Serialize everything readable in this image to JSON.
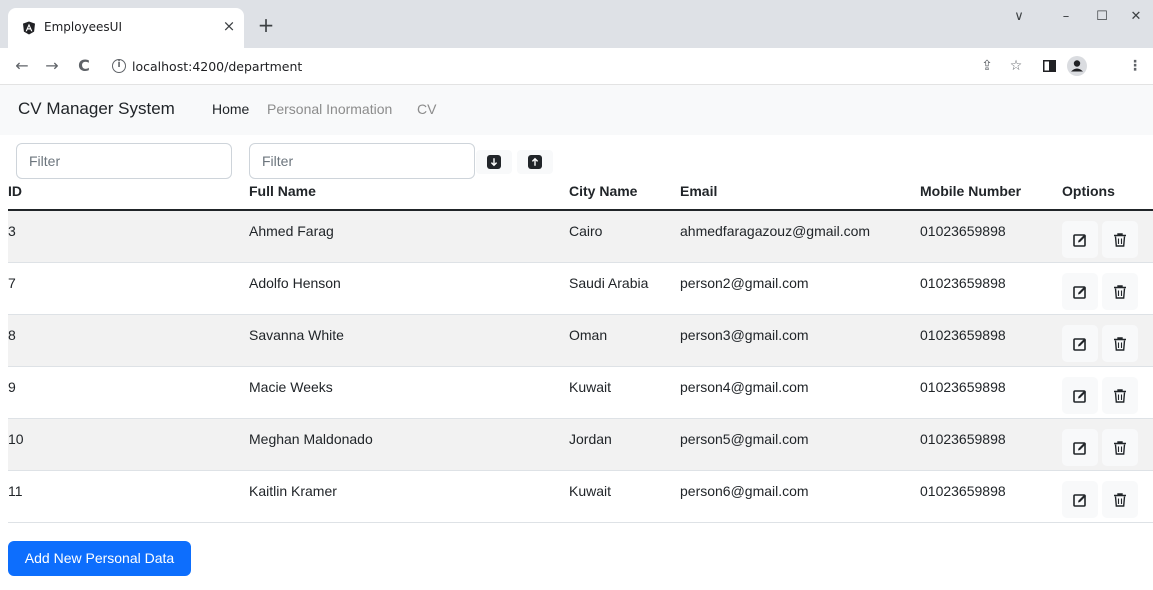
{
  "browser": {
    "tab_title": "EmployeesUI",
    "tab_close": "×",
    "new_tab": "+",
    "url": "localhost:4200/department",
    "controls": {
      "dropdown": "∨",
      "minimize": "–",
      "maximize": "☐",
      "close": "✕"
    },
    "nav": {
      "back": "←",
      "forward": "→",
      "reload": "C"
    },
    "icons": {
      "share": "⇪",
      "star": "☆",
      "menu": "⋮"
    }
  },
  "navbar": {
    "brand": "CV Manager System",
    "links": [
      {
        "label": "Home",
        "active": true
      },
      {
        "label": "Personal Inormation",
        "active": false
      },
      {
        "label": "CV",
        "active": false
      }
    ]
  },
  "filters": {
    "id_placeholder": "Filter",
    "name_placeholder": "Filter"
  },
  "table": {
    "headers": [
      "ID",
      "Full Name",
      "City Name",
      "Email",
      "Mobile Number",
      "Options"
    ],
    "rows": [
      {
        "id": "3",
        "name": "Ahmed Farag",
        "city": "Cairo",
        "email": "ahmedfaragazouz@gmail.com",
        "mobile": "01023659898"
      },
      {
        "id": "7",
        "name": "Adolfo Henson",
        "city": "Saudi Arabia",
        "email": "person2@gmail.com",
        "mobile": "01023659898"
      },
      {
        "id": "8",
        "name": "Savanna White",
        "city": "Oman",
        "email": "person3@gmail.com",
        "mobile": "01023659898"
      },
      {
        "id": "9",
        "name": "Macie Weeks",
        "city": "Kuwait",
        "email": "person4@gmail.com",
        "mobile": "01023659898"
      },
      {
        "id": "10",
        "name": "Meghan Maldonado",
        "city": "Jordan",
        "email": "person5@gmail.com",
        "mobile": "01023659898"
      },
      {
        "id": "11",
        "name": "Kaitlin Kramer",
        "city": "Kuwait",
        "email": "person6@gmail.com",
        "mobile": "01023659898"
      }
    ]
  },
  "actions": {
    "add_label": "Add New Personal Data"
  },
  "colors": {
    "primary": "#0d6efd",
    "striped_row": "#f2f2f2",
    "navbar_bg": "#f8f9fa",
    "muted_link": "#8c8c8c"
  }
}
